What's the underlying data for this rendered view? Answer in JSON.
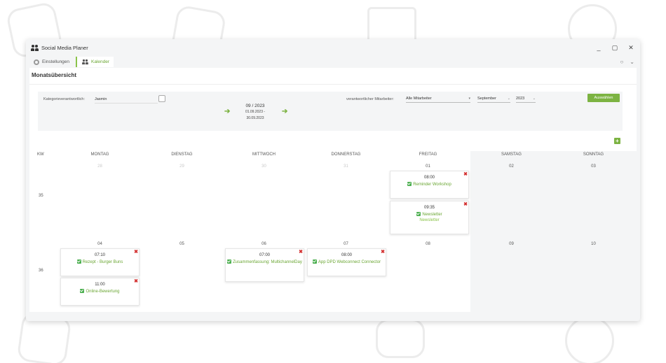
{
  "window": {
    "title": "Social Media Planer",
    "minimize_icon": "minimize-icon",
    "maximize_icon": "maximize-icon",
    "close_icon": "close-icon"
  },
  "tabs": [
    {
      "label": "Einstellungen",
      "icon": "gear-icon",
      "active": false
    },
    {
      "label": "Kalender",
      "icon": "people-icon",
      "active": true
    }
  ],
  "page": {
    "title": "Monatsübersicht"
  },
  "filter": {
    "category_label": "Kategorieverantwortlich:",
    "category_value": "Jasmin",
    "employee_label": "verantwortlicher Mitarbeiter:",
    "employee_value": "Alle Mitarbeiter",
    "month_value": "September",
    "year_value": "2023",
    "submit_label": "Auswählen",
    "period_main": "09 / 2023",
    "period_range_1": "01.09.2023 -",
    "period_range_2": "30.09.2023"
  },
  "calendar": {
    "kw_header": "KW",
    "days": [
      "MONTAG",
      "DIENSTAG",
      "MITTWOCH",
      "DONNERSTAG",
      "FREITAG",
      "SAMSTAG",
      "SONNTAG"
    ],
    "weeks": [
      {
        "kw": "35",
        "dates": [
          "28",
          "29",
          "30",
          "31",
          "01",
          "02",
          "03"
        ]
      },
      {
        "kw": "36",
        "dates": [
          "04",
          "05",
          "06",
          "07",
          "08",
          "09",
          "10"
        ]
      }
    ],
    "events": [
      {
        "time": "08:00",
        "title": "Reminder Workshop",
        "sub": ""
      },
      {
        "time": "09:35",
        "title": "Newsletter",
        "sub": "Newsletter"
      },
      {
        "time": "07:10",
        "title": "Rezept - Burger Buns",
        "sub": ""
      },
      {
        "time": "11:00",
        "title": "Online-Bewertung",
        "sub": ""
      },
      {
        "time": "07:00",
        "title": "Zusammenfassung: MultichannelDay",
        "sub": ""
      },
      {
        "time": "08:00",
        "title": "App DPD Webconnect Connector",
        "sub": ""
      }
    ]
  },
  "colors": {
    "accent": "#7cb342",
    "delete": "#d32f2f",
    "weekend": "#f4f5f6"
  }
}
